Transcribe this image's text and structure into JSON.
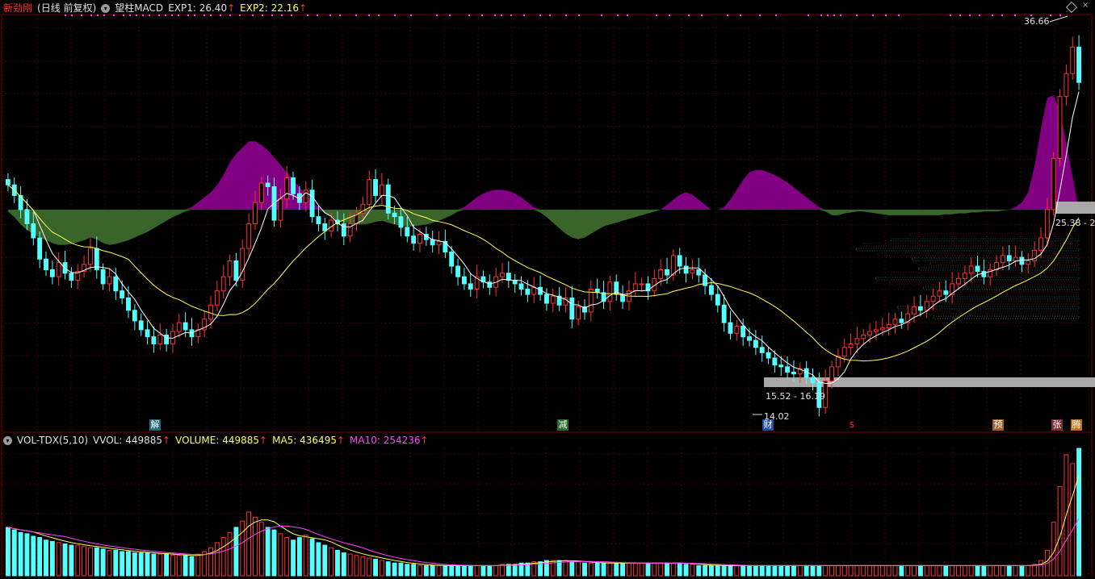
{
  "header": {
    "name": "新劲刚",
    "cycle": "(日线 前复权)",
    "indicator": "望柱MACD",
    "exp1_label": "EXP1: 26.40",
    "exp2_label": "EXP2: 22.16",
    "arrow": "↑"
  },
  "vol_header": {
    "name": "VOL-TDX(5,10)",
    "vvol": "VVOL: 449885",
    "volume": "VOLUME: 449885",
    "ma5": "MA5: 436495",
    "ma10": "MA10: 254236",
    "arrow": "↑"
  },
  "price_labels": {
    "high": "36.66",
    "low": "14.02",
    "zone_low": "15.52 - 16.19",
    "zone_high": "25.38 - 2"
  },
  "event_markers": [
    {
      "label": "解",
      "bg": "#1f6b7a",
      "fg": "#ffffff"
    },
    {
      "label": "减",
      "bg": "#2a6b2a",
      "fg": "#ffffff"
    },
    {
      "label": "财",
      "bg": "#2a4fa0",
      "fg": "#ffffff"
    },
    {
      "label": "$",
      "bg": "#000000",
      "fg": "#ff3030"
    },
    {
      "label": "预",
      "bg": "#a0602a",
      "fg": "#ffffff"
    },
    {
      "label": "张",
      "bg": "#7a3030",
      "fg": "#ffffff"
    },
    {
      "label": "腾",
      "bg": "#c07020",
      "fg": "#ffffff"
    }
  ],
  "colors": {
    "up": "#ff3232",
    "down": "#54ffff",
    "ma_short": "#ffffff",
    "ma_long": "#ffff55",
    "macd_pos": "#880088",
    "macd_neg": "#3c6a2c",
    "grid": "#7a0000",
    "zone": "#a8a8a8",
    "ma10_vol": "#ff44ff"
  },
  "chart_data": {
    "type": "candlestick",
    "price_range": [
      14.02,
      36.66
    ],
    "high_label": 36.66,
    "low_label": 14.02,
    "ohlc_close": [
      27.2,
      26.6,
      25.8,
      25.0,
      24.2,
      23.0,
      22.4,
      22.0,
      22.8,
      22.2,
      21.8,
      22.3,
      22.7,
      23.6,
      22.4,
      21.6,
      22.0,
      21.2,
      20.8,
      20.1,
      19.5,
      19.0,
      18.6,
      18.2,
      18.7,
      18.2,
      18.9,
      19.4,
      19.0,
      18.6,
      19.0,
      19.6,
      20.4,
      21.2,
      22.0,
      22.9,
      21.8,
      23.6,
      25.0,
      26.2,
      27.3,
      27.1,
      25.2,
      26.4,
      27.6,
      26.7,
      26.2,
      26.9,
      25.4,
      25.0,
      24.6,
      25.2,
      25.0,
      24.3,
      25.0,
      25.6,
      26.1,
      27.5,
      26.6,
      27.2,
      25.6,
      25.4,
      24.8,
      24.3,
      23.9,
      24.4,
      24.1,
      23.8,
      24.0,
      23.4,
      22.6,
      22.0,
      21.6,
      21.3,
      22.0,
      21.7,
      21.4,
      22.0,
      22.2,
      21.8,
      21.6,
      21.3,
      21.0,
      21.4,
      21.0,
      20.5,
      20.9,
      20.4,
      20.8,
      19.6,
      20.3,
      20.0,
      21.3,
      21.1,
      20.6,
      21.7,
      21.0,
      20.6,
      21.2,
      21.6,
      21.6,
      21.2,
      21.9,
      22.4,
      22.1,
      23.2,
      22.6,
      22.2,
      22.4,
      22.1,
      21.5,
      21.0,
      20.4,
      19.4,
      18.8,
      19.2,
      18.6,
      18.4,
      18.0,
      17.7,
      17.4,
      17.0,
      16.9,
      16.6,
      16.5,
      16.8,
      16.3,
      16.0,
      14.6,
      16.1,
      16.9,
      17.5,
      18.0,
      18.2,
      18.5,
      18.7,
      18.9,
      19.0,
      19.1,
      19.3,
      19.6,
      19.4,
      19.9,
      20.3,
      20.1,
      20.6,
      20.9,
      21.2,
      21.0,
      21.6,
      21.9,
      22.2,
      22.6,
      22.3,
      22.0,
      22.4,
      22.8,
      23.2,
      22.9,
      23.1,
      22.7,
      22.9,
      23.5,
      24.2,
      25.8,
      28.7,
      32.2,
      33.5,
      35.0,
      33.0
    ],
    "volume_rel": [
      0.38,
      0.36,
      0.34,
      0.33,
      0.31,
      0.3,
      0.28,
      0.27,
      0.26,
      0.25,
      0.24,
      0.24,
      0.23,
      0.22,
      0.22,
      0.21,
      0.2,
      0.2,
      0.19,
      0.19,
      0.18,
      0.18,
      0.18,
      0.17,
      0.17,
      0.17,
      0.16,
      0.16,
      0.16,
      0.15,
      0.17,
      0.19,
      0.22,
      0.26,
      0.3,
      0.34,
      0.38,
      0.43,
      0.5,
      0.46,
      0.42,
      0.38,
      0.36,
      0.33,
      0.3,
      0.28,
      0.3,
      0.32,
      0.29,
      0.26,
      0.24,
      0.22,
      0.2,
      0.18,
      0.17,
      0.16,
      0.15,
      0.14,
      0.13,
      0.12,
      0.11,
      0.1,
      0.1,
      0.09,
      0.09,
      0.08,
      0.08,
      0.08,
      0.08,
      0.08,
      0.08,
      0.08,
      0.08,
      0.08,
      0.08,
      0.08,
      0.08,
      0.08,
      0.09,
      0.09,
      0.09,
      0.1,
      0.1,
      0.11,
      0.11,
      0.12,
      0.12,
      0.12,
      0.12,
      0.11,
      0.11,
      0.1,
      0.1,
      0.1,
      0.1,
      0.1,
      0.1,
      0.1,
      0.1,
      0.1,
      0.1,
      0.1,
      0.1,
      0.1,
      0.1,
      0.1,
      0.1,
      0.09,
      0.09,
      0.08,
      0.08,
      0.08,
      0.08,
      0.08,
      0.08,
      0.08,
      0.08,
      0.08,
      0.08,
      0.08,
      0.08,
      0.08,
      0.08,
      0.08,
      0.08,
      0.08,
      0.08,
      0.08,
      0.08,
      0.08,
      0.08,
      0.08,
      0.08,
      0.08,
      0.08,
      0.08,
      0.08,
      0.08,
      0.08,
      0.08,
      0.08,
      0.08,
      0.08,
      0.08,
      0.08,
      0.08,
      0.08,
      0.08,
      0.08,
      0.08,
      0.08,
      0.08,
      0.08,
      0.08,
      0.08,
      0.08,
      0.08,
      0.08,
      0.08,
      0.08,
      0.08,
      0.08,
      0.09,
      0.12,
      0.2,
      0.42,
      0.7,
      0.95,
      0.88,
      1.0
    ],
    "macd_rel": [
      -0.02,
      -0.08,
      -0.16,
      -0.22,
      -0.26,
      -0.3,
      -0.33,
      -0.36,
      -0.38,
      -0.38,
      -0.37,
      -0.35,
      -0.33,
      -0.3,
      -0.32,
      -0.36,
      -0.38,
      -0.37,
      -0.35,
      -0.33,
      -0.3,
      -0.27,
      -0.24,
      -0.2,
      -0.16,
      -0.12,
      -0.08,
      -0.05,
      -0.02,
      0.02,
      0.06,
      0.1,
      0.14,
      0.2,
      0.28,
      0.38,
      0.45,
      0.5,
      0.55,
      0.55,
      0.52,
      0.48,
      0.42,
      0.36,
      0.3,
      0.24,
      0.18,
      0.12,
      0.06,
      0.02,
      -0.03,
      -0.08,
      -0.12,
      -0.14,
      -0.15,
      -0.16,
      -0.16,
      -0.15,
      -0.13,
      -0.12,
      -0.14,
      -0.16,
      -0.17,
      -0.18,
      -0.18,
      -0.17,
      -0.16,
      -0.14,
      -0.12,
      -0.09,
      -0.06,
      -0.02,
      0.02,
      0.06,
      0.1,
      0.13,
      0.15,
      0.16,
      0.16,
      0.15,
      0.13,
      0.1,
      0.06,
      0.02,
      -0.03,
      -0.08,
      -0.14,
      -0.2,
      -0.26,
      -0.3,
      -0.32,
      -0.3,
      -0.26,
      -0.22,
      -0.18,
      -0.16,
      -0.14,
      -0.12,
      -0.1,
      -0.08,
      -0.06,
      -0.04,
      -0.02,
      0.0,
      0.04,
      0.08,
      0.12,
      0.14,
      0.12,
      0.08,
      0.04,
      0.0,
      0.0,
      0.02,
      0.08,
      0.16,
      0.24,
      0.3,
      0.32,
      0.32,
      0.3,
      0.28,
      0.25,
      0.22,
      0.18,
      0.14,
      0.1,
      0.06,
      0.02,
      -0.02,
      -0.06,
      -0.06,
      -0.04,
      -0.03,
      -0.02,
      -0.02,
      -0.03,
      -0.04,
      -0.05,
      -0.06,
      -0.06,
      -0.06,
      -0.06,
      -0.06,
      -0.06,
      -0.06,
      -0.06,
      -0.06,
      -0.05,
      -0.05,
      -0.04,
      -0.04,
      -0.03,
      -0.03,
      -0.02,
      -0.02,
      -0.02,
      -0.01,
      0.0,
      0.02,
      0.06,
      0.14,
      0.35,
      0.65,
      0.9,
      0.92,
      0.8
    ]
  }
}
